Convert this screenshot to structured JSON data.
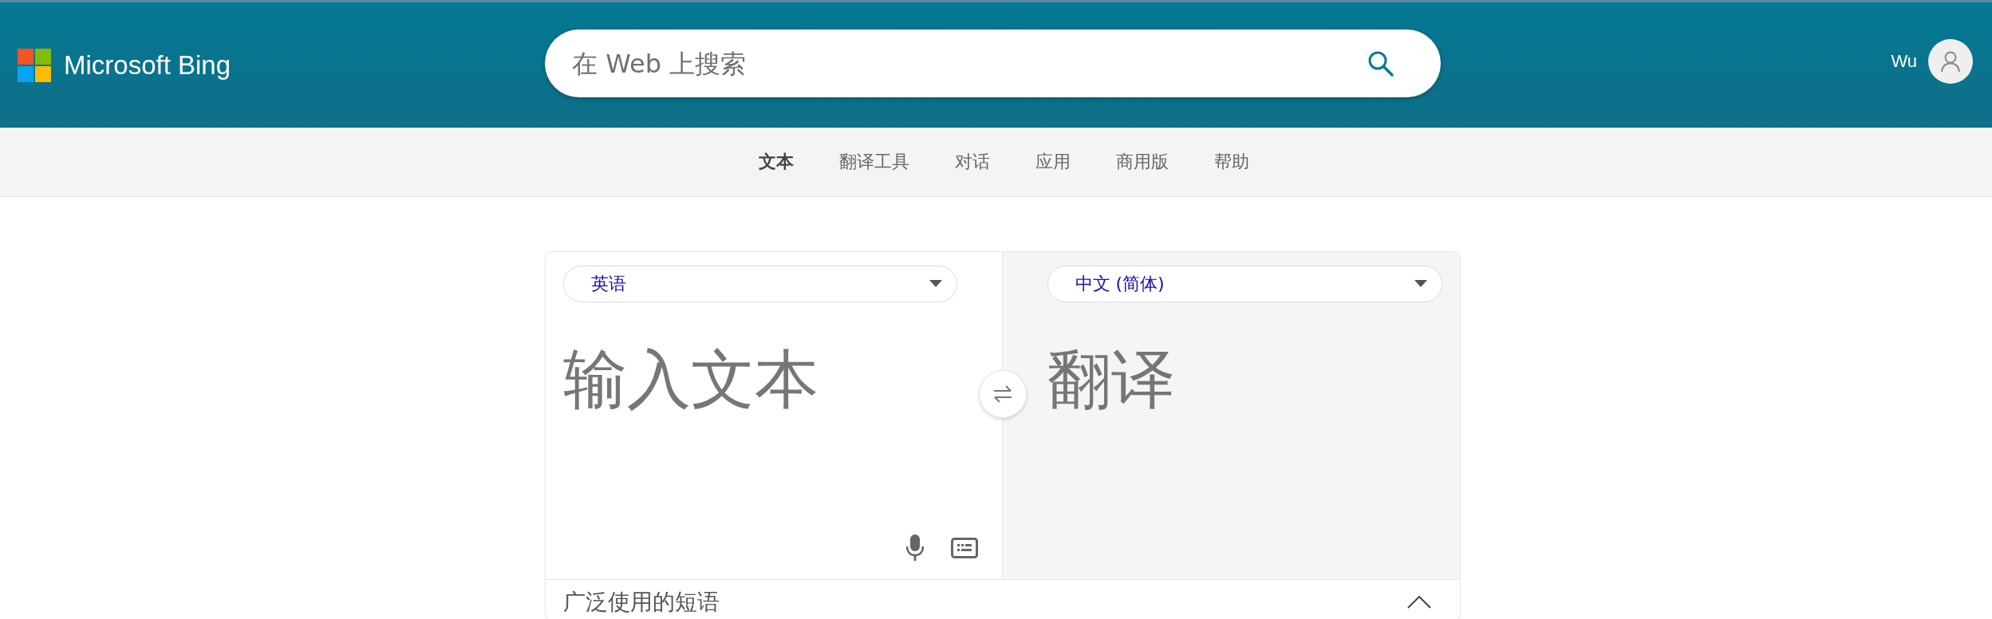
{
  "header": {
    "brand": "Microsoft Bing",
    "search": {
      "placeholder": "在 Web 上搜索"
    },
    "user": "Wu"
  },
  "nav": [
    {
      "label": "文本",
      "selected": true
    },
    {
      "label": "翻译工具",
      "selected": false
    },
    {
      "label": "对话",
      "selected": false
    },
    {
      "label": "应用",
      "selected": false
    },
    {
      "label": "商用版",
      "selected": false
    },
    {
      "label": "帮助",
      "selected": false
    }
  ],
  "translator": {
    "source_language": "英语",
    "target_language": "中文 (简体)",
    "input": {
      "placeholder": "输入文本"
    },
    "output": {
      "placeholder": "翻译"
    }
  },
  "phrases": {
    "title": "广泛使用的短语",
    "expanded": true
  }
}
